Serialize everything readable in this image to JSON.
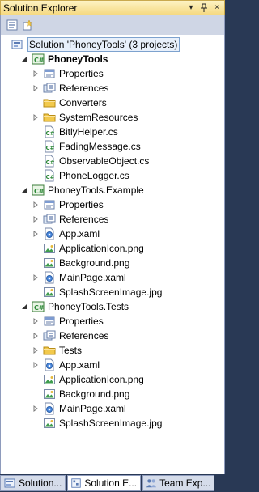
{
  "window": {
    "title": "Solution Explorer",
    "pin_glyph": "▾",
    "autohide_glyph": "↕",
    "close_glyph": "×"
  },
  "solution": {
    "label": "Solution 'PhoneyTools' (3 projects)"
  },
  "projects": [
    {
      "name": "PhoneyTools",
      "items": [
        {
          "label": "Properties",
          "icon": "properties-icon",
          "expander": true
        },
        {
          "label": "References",
          "icon": "references-icon",
          "expander": true
        },
        {
          "label": "Converters",
          "icon": "folder-icon",
          "expander": false
        },
        {
          "label": "SystemResources",
          "icon": "folder-icon",
          "expander": true
        },
        {
          "label": "BitlyHelper.cs",
          "icon": "csharp-file-icon",
          "expander": false
        },
        {
          "label": "FadingMessage.cs",
          "icon": "csharp-file-icon",
          "expander": false
        },
        {
          "label": "ObservableObject.cs",
          "icon": "csharp-file-icon",
          "expander": false
        },
        {
          "label": "PhoneLogger.cs",
          "icon": "csharp-file-icon",
          "expander": false
        }
      ]
    },
    {
      "name": "PhoneyTools.Example",
      "items": [
        {
          "label": "Properties",
          "icon": "properties-icon",
          "expander": true
        },
        {
          "label": "References",
          "icon": "references-icon",
          "expander": true
        },
        {
          "label": "App.xaml",
          "icon": "xaml-file-icon",
          "expander": true
        },
        {
          "label": "ApplicationIcon.png",
          "icon": "image-file-icon",
          "expander": false
        },
        {
          "label": "Background.png",
          "icon": "image-file-icon",
          "expander": false
        },
        {
          "label": "MainPage.xaml",
          "icon": "xaml-file-icon",
          "expander": true
        },
        {
          "label": "SplashScreenImage.jpg",
          "icon": "image-file-icon",
          "expander": false
        }
      ]
    },
    {
      "name": "PhoneyTools.Tests",
      "items": [
        {
          "label": "Properties",
          "icon": "properties-icon",
          "expander": true
        },
        {
          "label": "References",
          "icon": "references-icon",
          "expander": true
        },
        {
          "label": "Tests",
          "icon": "folder-icon",
          "expander": true
        },
        {
          "label": "App.xaml",
          "icon": "xaml-file-icon",
          "expander": true
        },
        {
          "label": "ApplicationIcon.png",
          "icon": "image-file-icon",
          "expander": false
        },
        {
          "label": "Background.png",
          "icon": "image-file-icon",
          "expander": false
        },
        {
          "label": "MainPage.xaml",
          "icon": "xaml-file-icon",
          "expander": true
        },
        {
          "label": "SplashScreenImage.jpg",
          "icon": "image-file-icon",
          "expander": false
        }
      ]
    }
  ],
  "tabs": [
    {
      "label": "Solution...",
      "icon": "solution-icon",
      "active": false
    },
    {
      "label": "Solution E...",
      "icon": "solution-explorer-icon",
      "active": true
    },
    {
      "label": "Team Exp...",
      "icon": "team-explorer-icon",
      "active": false
    }
  ],
  "colors": {
    "title_bar": "#f5d981",
    "frame": "#293955",
    "selection_border": "#7da2ce",
    "folder": "#f2c94c",
    "csharp": "#2f8a3a"
  }
}
